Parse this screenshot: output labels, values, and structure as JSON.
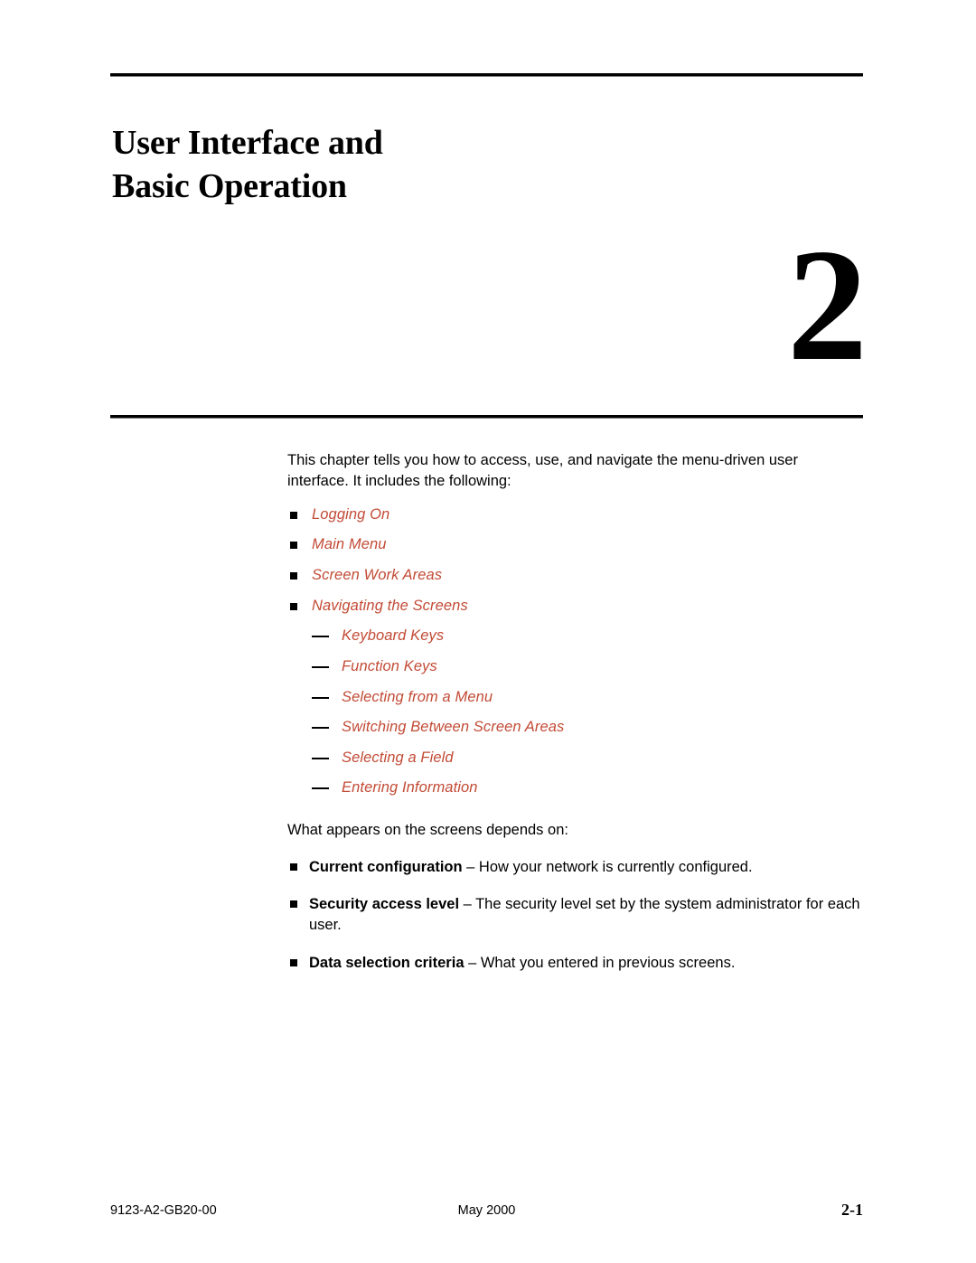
{
  "document": {
    "chapter_title_line1": "User Interface and",
    "chapter_title_line2": "Basic Operation",
    "chapter_number": "2",
    "link_color": "#C24B36"
  },
  "intro": {
    "paragraph": "This chapter tells you how to access, use, and navigate the menu-driven user interface. It includes the following:"
  },
  "topic_links": [
    {
      "label": "Logging On"
    },
    {
      "label": "Main Menu"
    },
    {
      "label": "Screen Work Areas"
    },
    {
      "label": "Navigating the Screens"
    }
  ],
  "sub_links": [
    {
      "label": "Keyboard Keys"
    },
    {
      "label": "Function Keys"
    },
    {
      "label": "Selecting from a Menu"
    },
    {
      "label": "Switching Between Screen Areas"
    },
    {
      "label": "Selecting a Field"
    },
    {
      "label": "Entering Information"
    }
  ],
  "depends": {
    "intro": "What appears on the screens depends on:",
    "items": [
      {
        "term": "Current configuration",
        "description": " – How your network is currently configured."
      },
      {
        "term": "Security access level",
        "description": " – The security level set by the system administrator for each user."
      },
      {
        "term": "Data selection criteria",
        "description": " – What you entered in previous screens."
      }
    ]
  },
  "footer": {
    "document_number": "9123-A2-GB20-00",
    "date": "May 2000",
    "page_number": "2-1"
  }
}
